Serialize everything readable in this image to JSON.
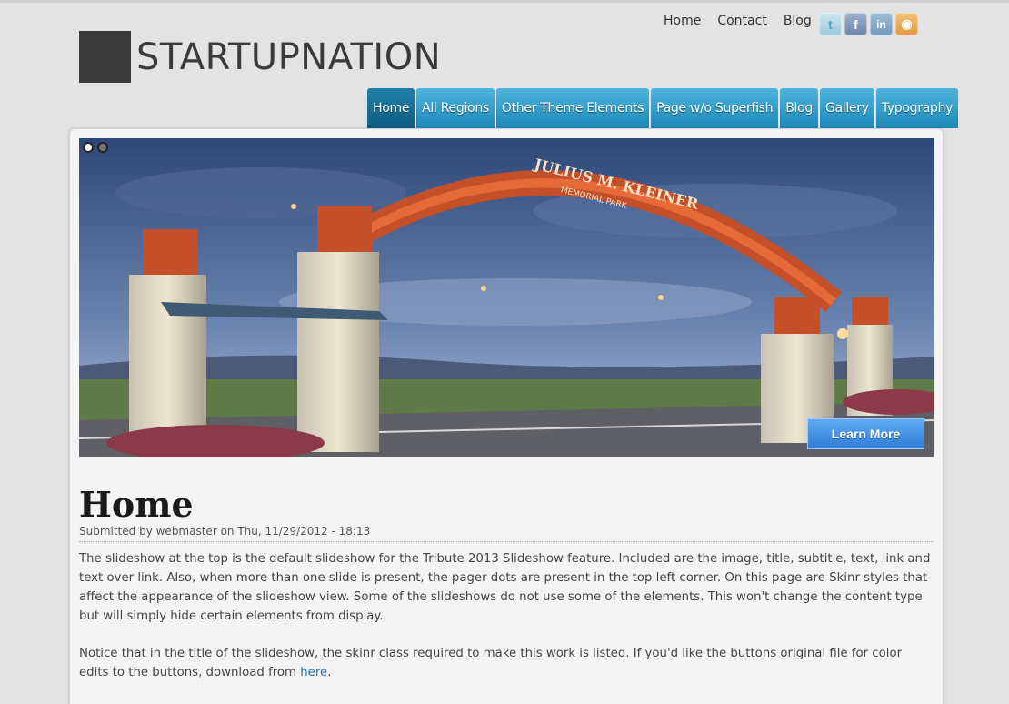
{
  "header": {
    "top_links": [
      "Home",
      "Contact",
      "Blog"
    ],
    "social": [
      {
        "name": "twitter-icon",
        "glyph": "t"
      },
      {
        "name": "facebook-icon",
        "glyph": "f"
      },
      {
        "name": "linkedin-icon",
        "glyph": "in"
      },
      {
        "name": "rss-icon",
        "glyph": "◉"
      }
    ],
    "logo_text": "STARTUPNATION"
  },
  "nav": {
    "items": [
      "Home",
      "All Regions",
      "Other Theme Elements",
      "Page w/o Superfish",
      "Blog",
      "Gallery",
      "Typography"
    ],
    "active_index": 0
  },
  "slideshow": {
    "pager_count": 2,
    "active_slide": 0,
    "button_label": "Learn More",
    "arch_text_line1": "JULIUS M. KLEINER",
    "arch_text_line2": "MEMORIAL PARK"
  },
  "content": {
    "title": "Home",
    "submitted": "Submitted by webmaster on Thu, 11/29/2012 - 18:13",
    "paragraph1": "The slideshow at the top is the default slideshow for the Tribute 2013 Slideshow feature. Included are the image, title, subtitle, text, link and text over link. Also, when more than one slide is present, the pager dots are present in the top left corner. On this page are Skinr styles that affect the appearance of the slideshow view. Some of the slideshows do not use some of the elements. This won't change the content type but will simply hide certain elements from display.",
    "paragraph2_before": "Notice that in the title of the slideshow, the skinr class required to make this work is listed. If you'd like the buttons original file for color edits to the buttons, download from ",
    "paragraph2_link": "here",
    "paragraph2_after": "."
  },
  "colors": {
    "nav_tab": "#2a9fd0",
    "nav_active": "#12668c",
    "link": "#2a6fa8"
  }
}
